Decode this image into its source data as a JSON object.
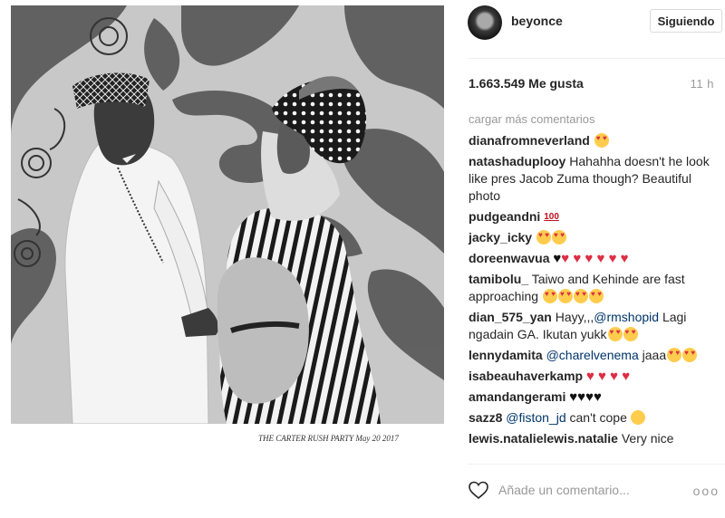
{
  "post": {
    "photo_caption": "THE CARTER RUSH PARTY  May 20 2017",
    "author": {
      "username": "beyonce",
      "avatar_icon": "profile-avatar"
    },
    "follow_label": "Siguiendo",
    "likes": "1.663.549 Me gusta",
    "time": "11 h",
    "load_more": "cargar más comentarios",
    "comments": [
      {
        "user": "dianafromneverland",
        "text": ""
      },
      {
        "user": "natashaduplooy",
        "text": "Hahahha doesn't he look like pres Jacob Zuma though? Beautiful photo"
      },
      {
        "user": "pudgeandni",
        "text": ""
      },
      {
        "user": "jacky_icky",
        "text": ""
      },
      {
        "user": "doreenwavua",
        "text": ""
      },
      {
        "user": "tamibolu_",
        "text": "Taiwo and Kehinde are fast approaching"
      },
      {
        "user": "dian_575_yan",
        "text_before": "Hayy,,,",
        "mention": "@rmshopid",
        "text_after": " Lagi ngadain GA. Ikutan yukk"
      },
      {
        "user": "lennydamita",
        "mention": "@charelvenema",
        "text_after": " jaaa"
      },
      {
        "user": "isabeauhaverkamp",
        "text": ""
      },
      {
        "user": "amandangerami",
        "text": ""
      },
      {
        "user": "sazz8",
        "mention": "@fiston_jd",
        "text_after": " can't cope"
      },
      {
        "user": "lewis.natalielewis.natalie",
        "text": "Very nice"
      }
    ],
    "add_comment_placeholder": "Añade un comentario...",
    "more_options": "ooo",
    "colors": {
      "link": "#003569",
      "muted": "#999999",
      "text": "#262626",
      "border": "#dbdbdb",
      "heart": "#dd2e44"
    }
  }
}
